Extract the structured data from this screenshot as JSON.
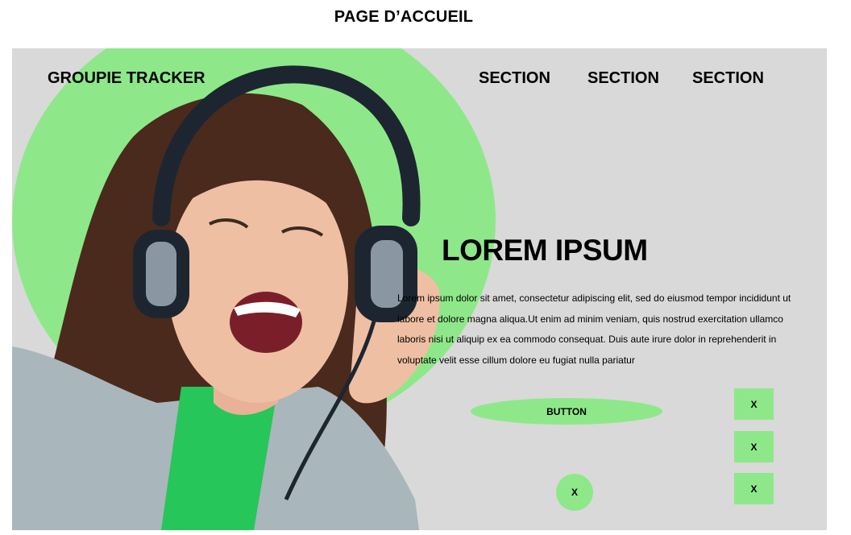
{
  "page": {
    "title": "PAGE D’ACCUEIL"
  },
  "header": {
    "brand": "GROUPIE TRACKER",
    "nav": [
      "SECTION",
      "SECTION",
      "SECTION"
    ]
  },
  "hero": {
    "title": "LOREM IPSUM",
    "text": "Lorem ipsum dolor sit amet, consectetur adipiscing elit, sed do eiusmod tempor incididunt ut labore et dolore magna aliqua.Ut enim ad minim veniam, quis nostrud exercitation ullamco laboris nisi ut aliquip ex ea commodo consequat. Duis aute irure dolor in reprehenderit in voluptate velit esse cillum dolore eu fugiat nulla pariatur",
    "button": "BUTTON"
  },
  "controls": {
    "square_buttons": [
      "X",
      "X",
      "X"
    ],
    "round_button": "X"
  },
  "colors": {
    "accent": "#8ee88a",
    "panel": "#d9d9d9",
    "skin": "#efbfa3",
    "hair": "#4a2a1c",
    "headphones": "#1d2630",
    "shirt": "#27c65a",
    "cardigan": "#a9b6bb"
  },
  "icons": {
    "hero_photo": "woman-with-headphones-illustration"
  }
}
